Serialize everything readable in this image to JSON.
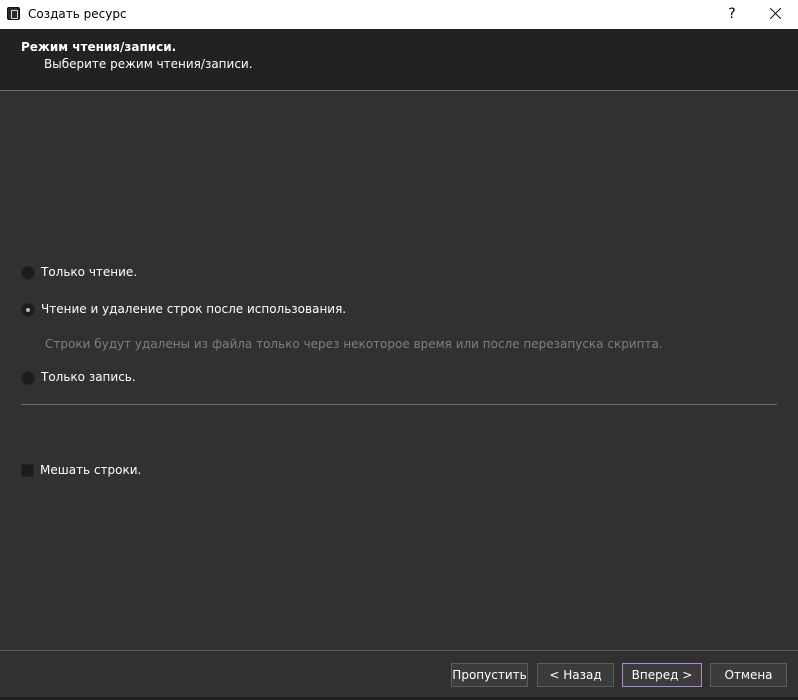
{
  "window": {
    "title": "Создать ресурс",
    "help_label": "?",
    "icon": "app-icon"
  },
  "header": {
    "title": "Режим чтения/записи.",
    "subtitle": "Выберите режим чтения/записи."
  },
  "options": [
    {
      "label": "Только чтение.",
      "checked": false
    },
    {
      "label": "Чтение и удаление строк после использования.",
      "checked": true
    },
    {
      "label": "Только запись.",
      "checked": false
    }
  ],
  "hint": "Строки будут удалены из файла только через некоторое время или после перезапуска скрипта.",
  "shuffle": {
    "label": "Мешать строки.",
    "checked": false
  },
  "buttons": {
    "skip": "Пропустить",
    "back": "< Назад",
    "next": "Вперед >",
    "cancel": "Отмена"
  },
  "colors": {
    "background": "#313131",
    "header_background": "#222222",
    "primary_border": "#b189c9",
    "hint_text": "#7f7f7f"
  }
}
